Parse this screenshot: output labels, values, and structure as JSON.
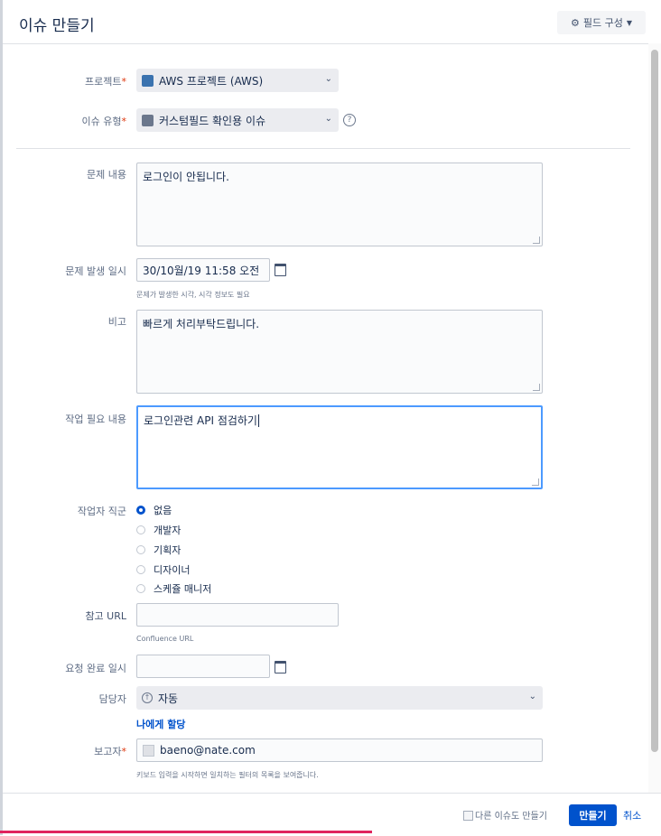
{
  "header": {
    "title": "이슈 만들기",
    "field_config": "필드 구성"
  },
  "project": {
    "label": "프로젝트",
    "value": "AWS 프로젝트 (AWS)"
  },
  "issue_type": {
    "label": "이슈 유형",
    "value": "커스텀필드 확인용 이슈"
  },
  "problem": {
    "label": "문제 내용",
    "value": "로그인이 안됩니다."
  },
  "occurred": {
    "label": "문제 발생 일시",
    "value": "30/10월/19 11:58 오전",
    "hint": "문제가 발생한 시각, 시각 정보도 필요"
  },
  "note": {
    "label": "비고",
    "value": "빠르게 처리부탁드립니다."
  },
  "work": {
    "label": "작업 필요 내용",
    "value": "로그인관련 API 점검하기"
  },
  "role": {
    "label": "작업자 직군",
    "options": [
      "없음",
      "개발자",
      "기획자",
      "디자이너",
      "스케쥴 매니저"
    ],
    "selected": "없음"
  },
  "ref_url": {
    "label": "참고 URL",
    "value": "",
    "hint": "Confluence URL"
  },
  "request_done": {
    "label": "요청 완료 일시",
    "value": ""
  },
  "assignee": {
    "label": "담당자",
    "value": "자동",
    "assign_me": "나에게 할당"
  },
  "reporter": {
    "label": "보고자",
    "value": "baeno@nate.com",
    "hint": "키보드 입력을 시작하면 일치하는 필터의 목록을 보여줍니다."
  },
  "footer": {
    "create_another": "다른 이슈도 만들기",
    "create": "만들기",
    "cancel": "취소"
  },
  "colors": {
    "primary": "#0052cc",
    "required": "#de350b",
    "focus": "#4c9aff"
  }
}
